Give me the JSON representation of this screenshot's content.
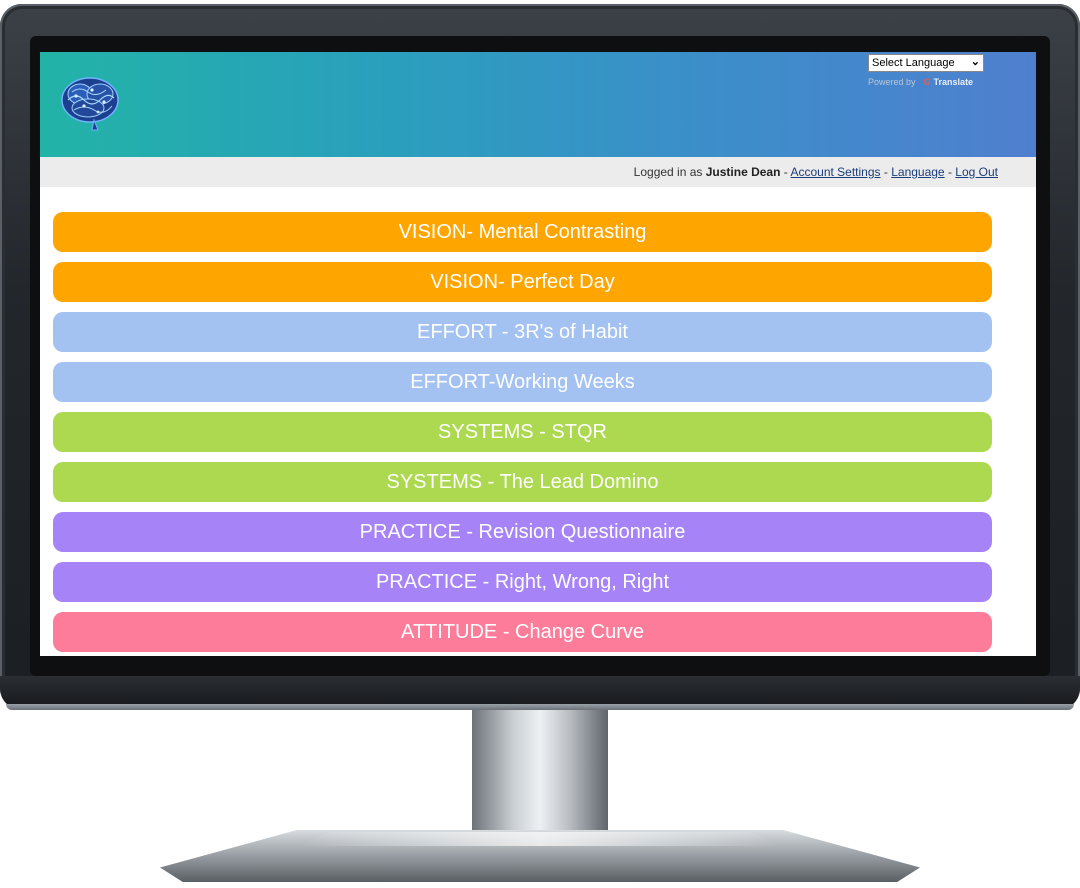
{
  "translate_widget": {
    "select_value": "Select Language",
    "powered_by": "Powered by",
    "google_glyph": "G",
    "translate_label": "Translate"
  },
  "login_bar": {
    "prefix": "Logged in as",
    "user_name": "Justine Dean",
    "separator": "-",
    "links": [
      "Account Settings",
      "Language",
      "Log Out"
    ]
  },
  "menu": {
    "items": [
      {
        "label": "VISION- Mental Contrasting",
        "color": "#ffa500"
      },
      {
        "label": "VISION- Perfect Day",
        "color": "#ffa500"
      },
      {
        "label": "EFFORT - 3R's of Habit",
        "color": "#a3c2f2"
      },
      {
        "label": "EFFORT-Working Weeks",
        "color": "#a3c2f2"
      },
      {
        "label": "SYSTEMS - STQR",
        "color": "#acd94f"
      },
      {
        "label": "SYSTEMS - The Lead Domino",
        "color": "#acd94f"
      },
      {
        "label": "PRACTICE - Revision Questionnaire",
        "color": "#a683f7"
      },
      {
        "label": "PRACTICE - Right, Wrong, Right",
        "color": "#a683f7"
      },
      {
        "label": "ATTITUDE - Change Curve",
        "color": "#fc7c9a"
      }
    ]
  },
  "colors": {
    "header_gradient_start": "#22b3a7",
    "header_gradient_end": "#4f7fcf",
    "login_bar_bg": "#ececec"
  },
  "icons": {
    "logo": "brain-logo-icon",
    "dropdown": "chevron-down-icon"
  }
}
